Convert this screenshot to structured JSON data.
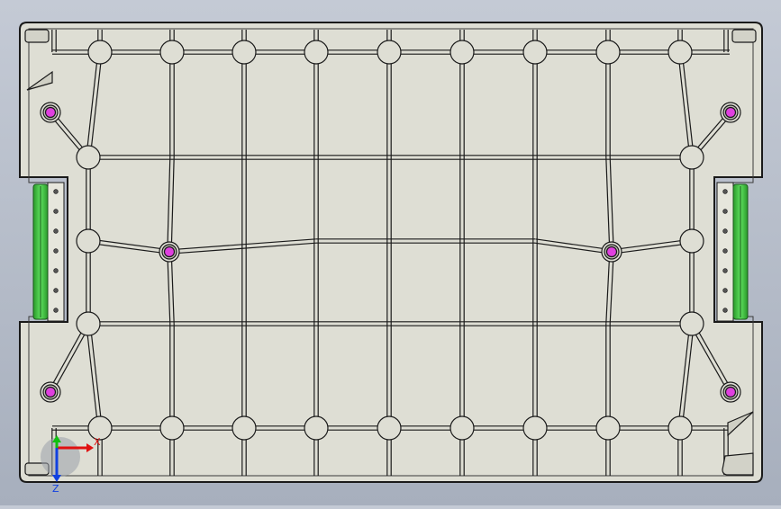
{
  "viewport": {
    "background_top": "#c4cad5",
    "background_bottom": "#a7afbd"
  },
  "part": {
    "name": "crate-base-bottom-view",
    "face_color": "#deded4",
    "edge_color": "#1a1a1a",
    "boss_color": "#e040e0",
    "rail_color": "#3ec63e"
  },
  "triad": {
    "x_label": "X",
    "z_label": "Z",
    "x_color": "#e01010",
    "y_color": "#10c010",
    "z_color": "#1040e0"
  }
}
